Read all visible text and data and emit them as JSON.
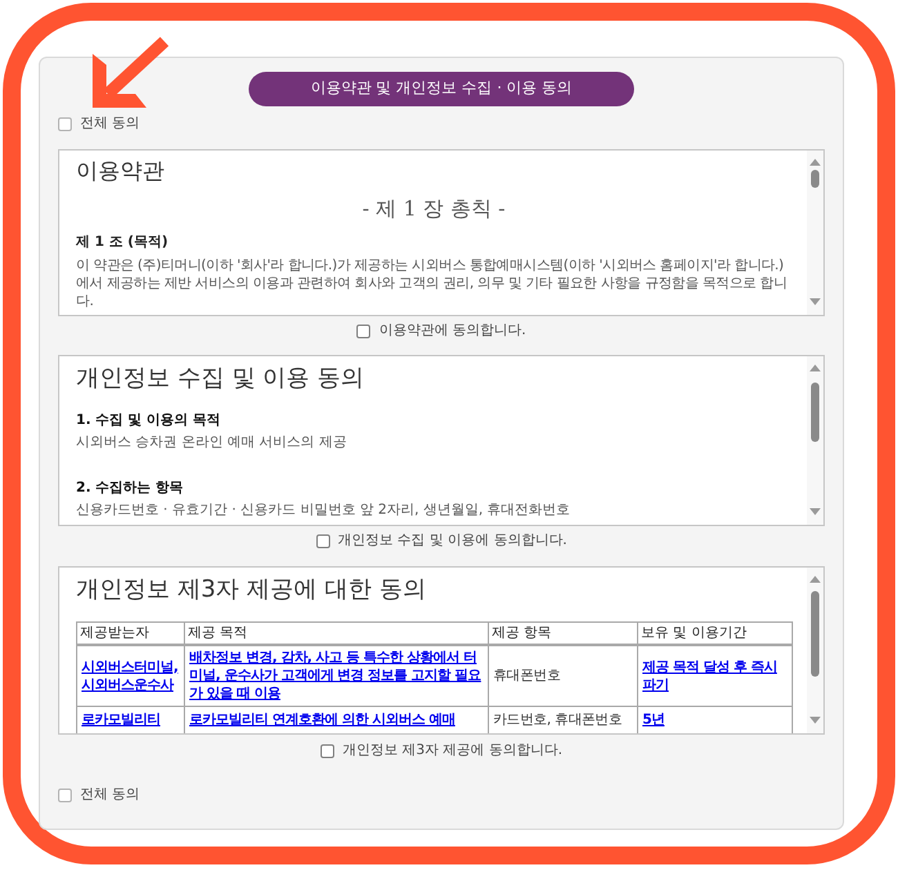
{
  "banner": {
    "title": "이용약관 및 개인정보 수집 · 이용 동의"
  },
  "agree_all_top": {
    "label": "전체 동의",
    "checked": false
  },
  "sections": [
    {
      "kind": "terms",
      "title": "이용약관",
      "chapter": "- 제 1 장 총칙 -",
      "article": "제 1 조 (목적)",
      "paragraph": "이 약관은 (주)티머니(이하 '회사'라 합니다.)가 제공하는 시외버스 통합예매시스템(이하 '시외버스 홈페이지'라 합니다.)에서 제공하는 제반 서비스의 이용과 관련하여 회사와 고객의 권리, 의무 및 기타 필요한 사항을 규정함을 목적으로 합니다.",
      "agreement": {
        "label": "이용약관에 동의합니다.",
        "checked": false
      }
    },
    {
      "kind": "list",
      "title": "개인정보 수집 및 이용 동의",
      "items": [
        {
          "heading": "1. 수집 및 이용의 목적",
          "text": "시외버스 승차권 온라인 예매 서비스의 제공"
        },
        {
          "heading": "2. 수집하는 항목",
          "text": "신용카드번호 · 유효기간 · 신용카드 비밀번호 앞 2자리, 생년월일, 휴대전화번호"
        }
      ],
      "agreement": {
        "label": "개인정보 수집 및 이용에 동의합니다.",
        "checked": false
      }
    },
    {
      "kind": "table",
      "title": "개인정보 제3자 제공에 대한 동의",
      "table": {
        "columns": [
          "제공받는자",
          "제공 목적",
          "제공 항목",
          "보유 및 이용기간"
        ],
        "rows": [
          {
            "cells": [
              {
                "kind": "link",
                "text": "시외버스터미널, 시외버스운수사"
              },
              {
                "kind": "link",
                "text": "배차정보 변경, 감차, 사고 등 특수한 상황에서 터미널, 운수사가 고객에게 변경 정보를 고지할 필요가 있을 때 이용"
              },
              {
                "kind": "plain",
                "text": "휴대폰번호"
              },
              {
                "kind": "link",
                "text": "제공 목적 달성 후 즉시 파기"
              }
            ]
          },
          {
            "cells": [
              {
                "kind": "link",
                "text": "로카모빌리티"
              },
              {
                "kind": "link",
                "text": "로카모빌리티 연계호환에 의한 시외버스 예매"
              },
              {
                "kind": "plain",
                "text": "카드번호, 휴대폰번호"
              },
              {
                "kind": "link",
                "text": "5년"
              }
            ]
          }
        ]
      },
      "agreement": {
        "label": "개인정보 제3자 제공에 동의합니다.",
        "checked": false
      }
    }
  ],
  "agree_all_bottom": {
    "label": "전체 동의",
    "checked": false
  }
}
